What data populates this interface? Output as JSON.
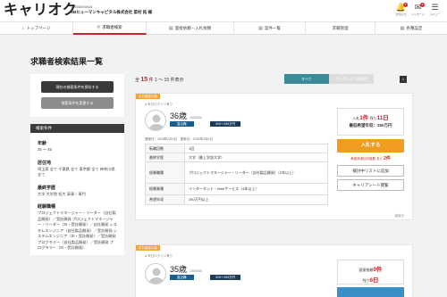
{
  "header": {
    "logo": "キャリオク",
    "company_id": "10000000044",
    "company_name": "SBヒューマンキャピタル株式会社 菜村 拓 様",
    "icons": [
      {
        "icon": "bell-icon",
        "glyph": "🔔",
        "label": "お知らせ",
        "badge": "6"
      },
      {
        "icon": "mail-icon",
        "glyph": "✉",
        "label": "メッセージ",
        "badge": "4"
      },
      {
        "icon": "menu-icon",
        "glyph": "☰",
        "label": "メニュー",
        "badge": ""
      }
    ]
  },
  "nav": [
    {
      "icon": "home-icon",
      "glyph": "⌂",
      "label": "トップページ",
      "active": false
    },
    {
      "icon": "search-icon",
      "glyph": "⚲",
      "label": "求職者検索",
      "active": true
    },
    {
      "icon": "list-icon",
      "glyph": "▤",
      "label": "面接依頼・入札依頼",
      "active": false
    },
    {
      "icon": "list-icon",
      "glyph": "▤",
      "label": "案件一覧",
      "active": false
    },
    {
      "icon": "",
      "glyph": "",
      "label": "求職管理",
      "active": false
    },
    {
      "icon": "doc-icon",
      "glyph": "▤",
      "label": "各種設定",
      "active": false
    }
  ],
  "page_title": "求職者検索結果一覧",
  "sidebar": {
    "btn_save": "現在の検索条件を保存する",
    "btn_change": "検索条件を変更する",
    "cond_heading": "検索条件",
    "conditions": [
      {
        "label": "年齢",
        "value": "25 ～ 45"
      },
      {
        "label": "居住地",
        "value": "埼玉県 全て 千葉県 全て 東京都 全て 神奈川県 全て"
      },
      {
        "label": "最終学歴",
        "value": "大学 大学院 短大 高専・専門"
      },
      {
        "label": "経験職種",
        "value": "プロジェクトマネージャー・リーダー（自社製品開発）／受託開発 プロジェクトマネージャー・リーダー（SI・受託開発）／自社開発 システムエンジニア（自社製品開発）／受託開発 システムエンジニア（SI・受託開発）／受託開発 プログラマー（自社製品開発）／受託開発 プログラマー（SI・受託開発）"
      }
    ]
  },
  "results": {
    "total_prefix": "全",
    "total": "15",
    "range": "件 1 ～ 15 件表示",
    "tab_all": "すべて",
    "tab_inactive": "オークション開催中",
    "page": "1"
  },
  "cards": [
    {
      "tag": "本日面接可能",
      "login": "● 本日ログイン有り",
      "age": "36歳",
      "id": "1000044",
      "tag1": "直近職",
      "tag2": "300～349万円",
      "registered": "登録日：2018年2月4日　更新日：2018年2月4日",
      "rows": [
        {
          "k": "転職回数",
          "v": "1回"
        },
        {
          "k": "最終学歴",
          "v": "大学（最上学部大学）"
        },
        {
          "k": "経験職種",
          "v": "プロジェクトマネージャー・リーダー（自社製品開発）（2年以上）"
        },
        {
          "k": "経験業種",
          "v": "インターネット・Webサービス（4年以上）"
        },
        {
          "k": "希望年収",
          "v": "250万円以上"
        }
      ],
      "bid_text": "入札",
      "bid_count": "1件",
      "bid_days_prefix": "残り",
      "bid_days": "11日",
      "max_bid": "最低希望年収：250万円",
      "btn_bid": "入札する",
      "note_prefix": "承認枠追加可能数",
      "note_left": "あと",
      "note_count": "2件",
      "btn_list": "検討中リストに追加",
      "btn_sheet": "キャリアシート閲覧",
      "more": "面接日"
    },
    {
      "tag": "本日面接可能",
      "login": "● 本日ログイン有り",
      "age": "35歳",
      "id": "1000040",
      "tag1": "直近職",
      "tag2": "300～349万円",
      "box_l1_prefix": "面接依頼",
      "box_l1_val": "0件",
      "box_l2_prefix": "残り",
      "box_l2_val": "6日"
    }
  ],
  "colors": {
    "accent_red": "#c1272d",
    "orange": "#f29c1f",
    "teal": "#3a8a98",
    "navy": "#1d5d8c"
  }
}
